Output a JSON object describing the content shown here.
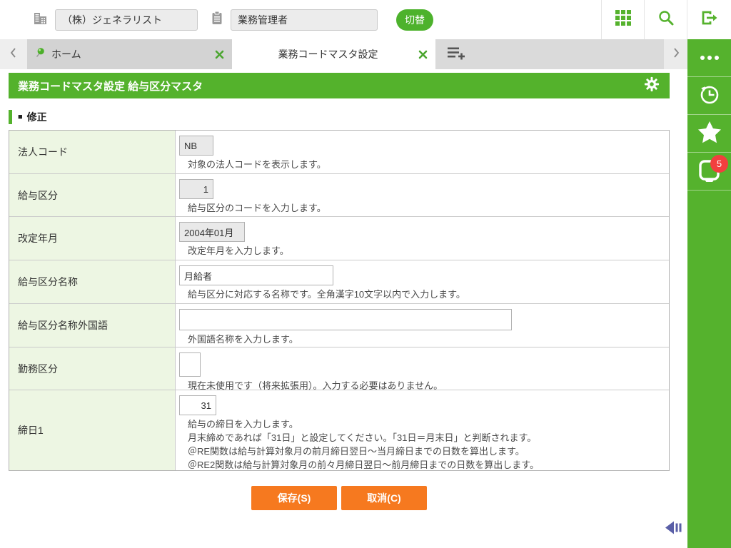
{
  "header": {
    "company_value": "（株）ジェネラリスト",
    "role_value": "業務管理者",
    "switch_label": "切替",
    "icons": {
      "left1": "building-icon",
      "left2": "clipboard-icon",
      "right": [
        "apps-grid-icon",
        "search-icon",
        "logout-icon"
      ]
    }
  },
  "tabbar": {
    "tabs": [
      {
        "label": "ホーム",
        "pinned": true,
        "active": false
      },
      {
        "label": "業務コードマスタ設定",
        "active": true
      }
    ],
    "icons": [
      "chevron-left-icon",
      "pin-icon",
      "close-icon",
      "add-tab-icon",
      "chevron-right-icon"
    ]
  },
  "sidebar": {
    "items": [
      {
        "icon": "ellipsis-icon"
      },
      {
        "icon": "history-icon"
      },
      {
        "icon": "star-icon"
      },
      {
        "icon": "tray-icon",
        "badge": "5"
      }
    ],
    "badge_count": "5"
  },
  "main": {
    "title": "業務コードマスタ設定 給与区分マスタ",
    "section_bullet": "■",
    "section_title": "修正",
    "form": {
      "rows": [
        {
          "label": "法人コード",
          "value": "NB",
          "readonly": true,
          "help": [
            "対象の法人コードを表示します。"
          ]
        },
        {
          "label": "給与区分",
          "value": "1",
          "readonly": true,
          "help": [
            "給与区分のコードを入力します。"
          ]
        },
        {
          "label": "改定年月",
          "value": "2004年01月",
          "readonly": true,
          "help": [
            "改定年月を入力します。"
          ]
        },
        {
          "label": "給与区分名称",
          "value": "月給者",
          "readonly": false,
          "help": [
            "給与区分に対応する名称です。全角漢字10文字以内で入力します。"
          ]
        },
        {
          "label": "給与区分名称外国語",
          "value": "",
          "readonly": false,
          "help": [
            "外国語名称を入力します。"
          ]
        },
        {
          "label": "勤務区分",
          "value": "",
          "readonly": false,
          "help": [
            "現在未使用です（将来拡張用）。入力する必要はありません。"
          ]
        },
        {
          "label": "締日1",
          "value": "31",
          "readonly": false,
          "help": [
            "給与の締日を入力します。",
            "月末締めであれば「31日」と設定してください。「31日＝月末日」と判断されます。",
            "＠RE関数は給与計算対象月の前月締日翌日～当月締日までの日数を算出します。",
            "＠RE2関数は給与計算対象月の前々月締日翌日～前月締日までの日数を算出します。"
          ]
        }
      ],
      "buttons": {
        "save": "保存(S)",
        "cancel": "取消(C)"
      }
    }
  },
  "colors": {
    "accent_green": "#55b22d",
    "button_orange": "#f6791f",
    "badge_red": "#f23f3f",
    "collapse_blue": "#5a5fa7",
    "label_cell_green": "#edf6e3"
  }
}
